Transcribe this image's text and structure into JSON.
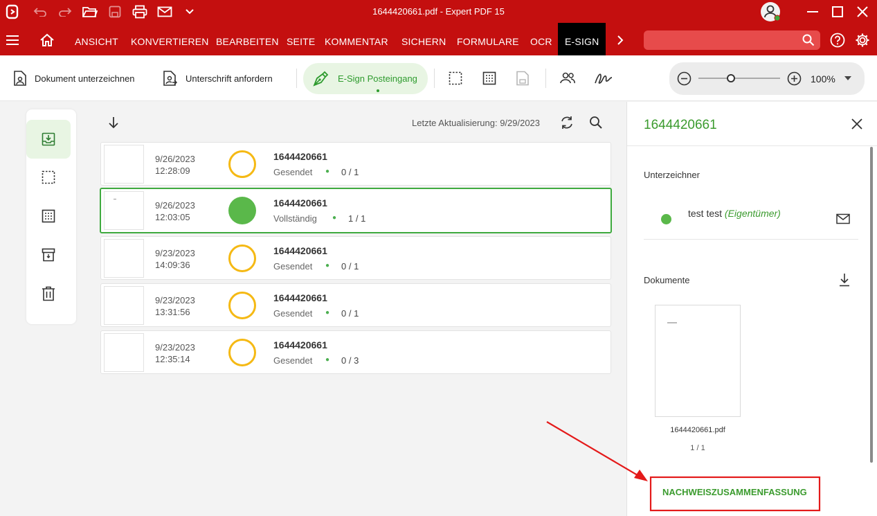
{
  "window": {
    "title": "1644420661.pdf - Expert PDF 15"
  },
  "menu": {
    "items": [
      "ANSICHT",
      "KONVERTIEREN",
      "BEARBEITEN",
      "SEITE",
      "KOMMENTAR",
      "SICHERN",
      "FORMULARE",
      "OCR"
    ],
    "active": "E-SIGN",
    "search_placeholder": ""
  },
  "toolbar": {
    "sign_document": "Dokument unterzeichnen",
    "request_signature": "Unterschrift anfordern",
    "esign_inbox": "E-Sign Posteingang",
    "zoom": "100%",
    "zoom_level": 0.4
  },
  "list": {
    "last_update": "Letzte Aktualisierung: 9/29/2023",
    "rows": [
      {
        "date": "9/26/2023",
        "time": "12:28:09",
        "name": "1644420661",
        "status": "Gesendet",
        "count": "0 / 1",
        "complete": false
      },
      {
        "date": "9/26/2023",
        "time": "12:03:05",
        "name": "1644420661",
        "status": "Vollständig",
        "count": "1 / 1",
        "complete": true
      },
      {
        "date": "9/23/2023",
        "time": "14:09:36",
        "name": "1644420661",
        "status": "Gesendet",
        "count": "0 / 1",
        "complete": false
      },
      {
        "date": "9/23/2023",
        "time": "13:31:56",
        "name": "1644420661",
        "status": "Gesendet",
        "count": "0 / 1",
        "complete": false
      },
      {
        "date": "9/23/2023",
        "time": "12:35:14",
        "name": "1644420661",
        "status": "Gesendet",
        "count": "0 / 3",
        "complete": false
      }
    ]
  },
  "panel": {
    "title": "1644420661",
    "signers_heading": "Unterzeichner",
    "signer_name": "test test",
    "signer_role": "(Eigentümer)",
    "documents_heading": "Dokumente",
    "doc_filename": "1644420661.pdf",
    "doc_pages": "1 / 1",
    "summary_button": "NACHWEISZUSAMMENFASSUNG"
  },
  "colors": {
    "brand_red": "#c40f0f",
    "green": "#3faa3f",
    "pending": "#f5b914",
    "annotation": "#e41a1a"
  }
}
